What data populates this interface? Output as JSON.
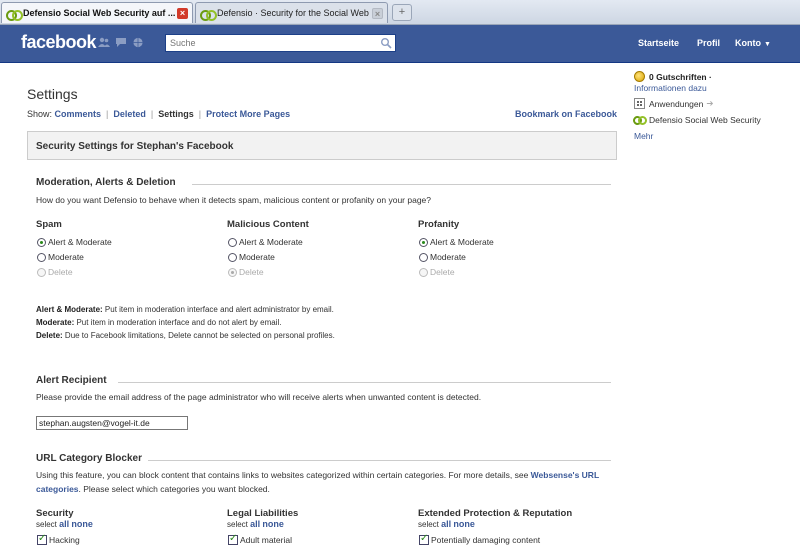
{
  "browser": {
    "tabs": [
      {
        "title": "Defensio Social Web Security auf ...",
        "active": true
      },
      {
        "title": "Defensio · Security for the Social Web",
        "active": false
      }
    ],
    "new_tab": "+"
  },
  "fbbar": {
    "logo": "facebook",
    "search_placeholder": "Suche",
    "nav": [
      "Startseite",
      "Profil",
      "Konto"
    ]
  },
  "page": {
    "title": "Settings",
    "show_label": "Show:",
    "show_links": [
      "Comments",
      "Deleted",
      "Settings",
      "Protect More Pages"
    ],
    "bookmark": "Bookmark on Facebook",
    "box_title": "Security Settings for Stephan's Facebook"
  },
  "moderation": {
    "heading": "Moderation, Alerts & Deletion",
    "description": "How do you want Defensio to behave when it detects spam, malicious content or profanity on your page?",
    "columns": [
      {
        "title": "Spam",
        "selected": "Alert & Moderate",
        "delete_selected": false
      },
      {
        "title": "Malicious Content",
        "selected": "Delete",
        "delete_selected": true
      },
      {
        "title": "Profanity",
        "selected": "Alert & Moderate",
        "delete_selected": false
      }
    ],
    "options": [
      "Alert & Moderate",
      "Moderate",
      "Delete"
    ],
    "legend": [
      {
        "term": "Alert & Moderate:",
        "text": " Put item in moderation interface and alert administrator by email."
      },
      {
        "term": "Moderate:",
        "text": " Put item in moderation interface and do not alert by email."
      },
      {
        "term": "Delete:",
        "text": " Due to Facebook limitations, Delete cannot be selected on personal profiles."
      }
    ]
  },
  "alert": {
    "heading": "Alert Recipient",
    "description": "Please provide the email address of the page administrator who will receive alerts when unwanted content is detected.",
    "email": "stephan.augsten@vogel-it.de"
  },
  "url_blocker": {
    "heading": "URL Category Blocker",
    "desc_part1": "Using this feature, you can block content that contains links to websites categorized within certain categories. For more details, see ",
    "desc_link1": "Websense's URL",
    "desc_link2": "categories",
    "desc_part2": ". Please select which categories you want blocked.",
    "select_label": "select",
    "all_label": "all",
    "none_label": "none",
    "categories": [
      {
        "title": "Security",
        "first_item": "Hacking",
        "checked": true
      },
      {
        "title": "Legal Liabilities",
        "first_item": "Adult material",
        "checked": true
      },
      {
        "title": "Extended Protection & Reputation",
        "first_item": "Potentially damaging content",
        "checked": true
      }
    ]
  },
  "sidebar": {
    "credits": "0 Gutschriften ·",
    "info": "Informationen dazu",
    "apps": "Anwendungen",
    "defensio": "Defensio Social Web Security",
    "more": "Mehr"
  }
}
